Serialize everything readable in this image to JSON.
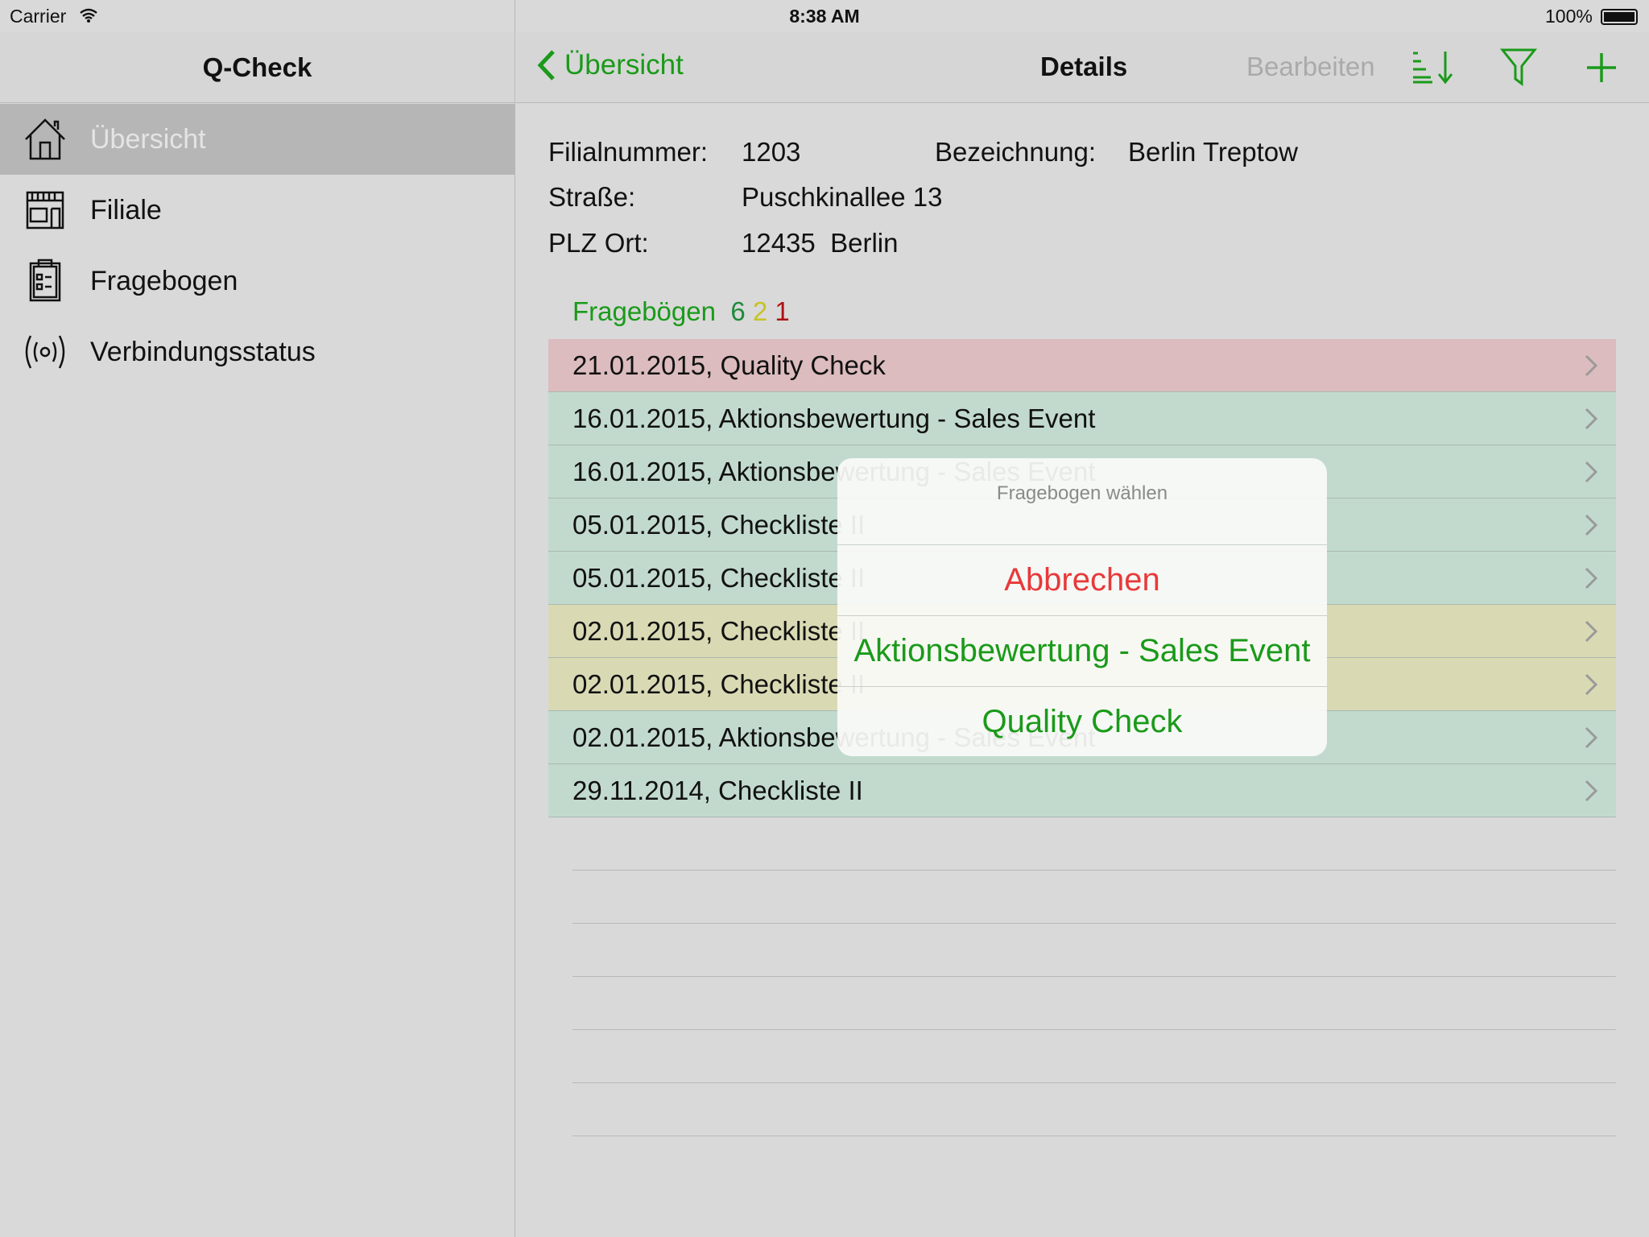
{
  "status_bar": {
    "carrier": "Carrier",
    "time": "8:38 AM",
    "battery": "100%"
  },
  "sidebar": {
    "title": "Q-Check",
    "items": [
      {
        "label": "Übersicht",
        "icon": "home-icon",
        "selected": true
      },
      {
        "label": "Filiale",
        "icon": "store-icon"
      },
      {
        "label": "Fragebogen",
        "icon": "clipboard-icon"
      },
      {
        "label": "Verbindungsstatus",
        "icon": "broadcast-icon"
      }
    ]
  },
  "detail_nav": {
    "back": "Übersicht",
    "title": "Details",
    "edit": "Bearbeiten"
  },
  "store": {
    "filialnummer_label": "Filialnummer:",
    "filialnummer": "1203",
    "bezeichnung_label": "Bezeichnung:",
    "bezeichnung": "Berlin Treptow",
    "strasse_label": "Straße:",
    "strasse": "Puschkinallee 13",
    "plz_label": "PLZ Ort:",
    "plz_ort": "12435  Berlin"
  },
  "questionnaires": {
    "header": "Fragebögen",
    "count_green": "6",
    "count_yellow": "2",
    "count_red": "1",
    "rows": [
      {
        "text": "21.01.2015, Quality Check",
        "status": "red"
      },
      {
        "text": "16.01.2015, Aktionsbewertung - Sales Event",
        "status": "green"
      },
      {
        "text": "16.01.2015, Aktionsbewertung - Sales Event",
        "status": "green"
      },
      {
        "text": "05.01.2015, Checkliste II",
        "status": "green"
      },
      {
        "text": "05.01.2015, Checkliste II",
        "status": "green"
      },
      {
        "text": "02.01.2015, Checkliste II",
        "status": "yellow"
      },
      {
        "text": "02.01.2015, Checkliste II",
        "status": "yellow"
      },
      {
        "text": "02.01.2015, Aktionsbewertung - Sales Event",
        "status": "green"
      },
      {
        "text": "29.11.2014, Checkliste II",
        "status": "green"
      }
    ]
  },
  "popover": {
    "title": "Fragebogen wählen",
    "cancel": "Abbrechen",
    "options": [
      "Aktionsbewertung - Sales Event",
      "Quality Check"
    ]
  },
  "colors": {
    "accent": "#1a9a1a",
    "red_row": "#dcbcbe",
    "green_row": "#c2dace",
    "yellow_row": "#d9dab4",
    "cancel": "#e8393a"
  }
}
